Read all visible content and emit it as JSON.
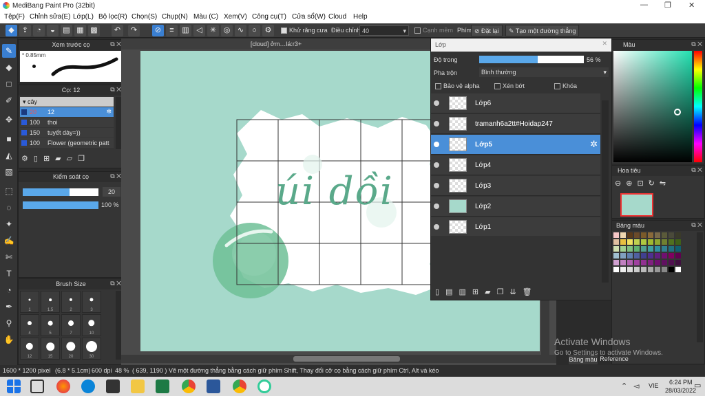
{
  "app": {
    "title": "MediBang Paint Pro (32bit)",
    "win_min": "—",
    "win_max": "❐",
    "win_close": "✕"
  },
  "menu": [
    "Tệp(F)",
    "Chỉnh sửa(E)",
    "Lớp(L)",
    "Bộ lọc(R)",
    "Chọn(S)",
    "Chụp(N)",
    "Màu (C)",
    "Xem(V)",
    "Công cụ(T)",
    "Cửa sổ(W)",
    "Cloud",
    "Help"
  ],
  "toolbar": {
    "antialias": "Khử răng cưa",
    "adjust_label": "Điều chỉnh",
    "adjust_value": "40",
    "smooth_edge": "Cạnh mềm",
    "key_label": "Phím",
    "reset": "Đặt lại",
    "line_tool": "Tạo một đường thẳng"
  },
  "brush_preview": {
    "title": "Xem trước cọ",
    "size": "* 0.85mm"
  },
  "brush_list": {
    "title": "Cọ: 12",
    "group": "cây",
    "items": [
      {
        "size": "20",
        "name": "12",
        "selected": true
      },
      {
        "size": "100",
        "name": "thoi",
        "selected": false
      },
      {
        "size": "150",
        "name": "tuyết dày=))",
        "selected": false
      },
      {
        "size": "100",
        "name": "Flower (geometric patt",
        "selected": false
      }
    ]
  },
  "brush_control": {
    "title": "Kiểm soát cọ",
    "size": "20",
    "opacity": "100 %",
    "size_fill": 0.62,
    "opacity_fill": 1.0
  },
  "brush_size": {
    "title": "Brush Size",
    "labels": [
      "1",
      "1.5",
      "2",
      "3",
      "4",
      "5",
      "7",
      "10",
      "12",
      "15",
      "20",
      "30"
    ]
  },
  "document": {
    "tab": "[cloud] ởm…lá:r3+",
    "canvas_text": "úi dồi"
  },
  "layer_panel": {
    "title": "Lớp",
    "opacity_label": "Độ trong",
    "opacity_value": "56 %",
    "opacity_fill": 0.56,
    "blend_label": "Pha trộn",
    "blend_value": "Bình thường",
    "protect_alpha": "Bảo vệ alpha",
    "clip": "Xén bớt",
    "lock": "Khóa",
    "layers": [
      {
        "name": "Lớp6",
        "selected": false
      },
      {
        "name": "tramanh6a2tt#Hoidap247",
        "selected": false
      },
      {
        "name": "Lớp5",
        "selected": true
      },
      {
        "name": "Lớp4",
        "selected": false
      },
      {
        "name": "Lớp3",
        "selected": false
      },
      {
        "name": "Lớp2",
        "selected": false
      },
      {
        "name": "Lớp1",
        "selected": false
      }
    ]
  },
  "color_panel": {
    "title": "Màu"
  },
  "navigator": {
    "title": "Hoa tiêu"
  },
  "palette": {
    "title": "Bảng màu",
    "tab1": "Bảng màu",
    "tab2": "Reference"
  },
  "watermark": {
    "line1": "Activate Windows",
    "line2": "Go to Settings to activate Windows."
  },
  "status": {
    "size": "1600 * 1200 pixel",
    "cm": "(6.8 * 5.1cm)",
    "dpi": "600 dpi",
    "zoom": "48 %",
    "coords": "( 639, 1190 )",
    "hint": "Vẽ một đường thẳng bằng cách giữ phím Shift, Thay đổi cỡ cọ bằng cách giữ phím Ctrl, Alt và kéo"
  },
  "taskbar": {
    "lang": "VIE",
    "time": "6:24 PM",
    "date": "28/03/2022"
  },
  "colors": {
    "accent": "#3a7fd1",
    "canvas_bg": "#a6d9cb",
    "text_green": "#5aa98a"
  }
}
